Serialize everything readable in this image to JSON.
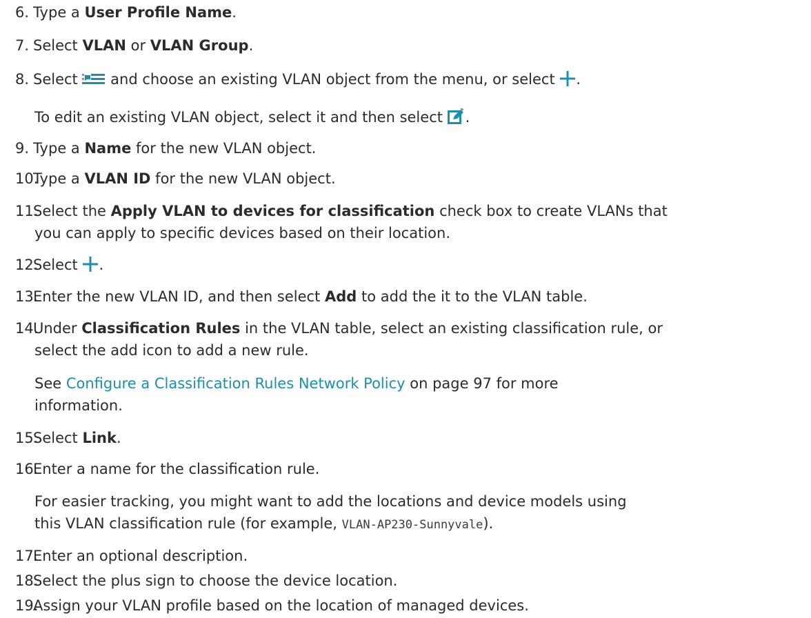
{
  "steps": [
    {
      "num": "6.",
      "pre": "Type a ",
      "bold": "User Profile Name",
      "post": "."
    },
    {
      "num": "7.",
      "pre": "Select ",
      "bold": "VLAN",
      "mid": " or ",
      "bold2": "VLAN Group",
      "post": "."
    },
    {
      "num": "8.",
      "pre": "Select ",
      "mid": " and choose an existing VLAN object from the menu, or select ",
      "post": "."
    },
    {
      "num": "9.",
      "pre": "Type a ",
      "bold": "Name",
      "post": " for the new VLAN object."
    },
    {
      "num": "10.",
      "pre": "Type a ",
      "bold": "VLAN ID",
      "post": " for the new VLAN object."
    },
    {
      "num": "11.",
      "pre": "Select the ",
      "bold": "Apply VLAN to devices for classification",
      "post": " check box to create VLANs that",
      "line2": "you can apply to specific devices based on their location."
    },
    {
      "num": "12.",
      "pre": "Select ",
      "post": "."
    },
    {
      "num": "13.",
      "pre": "Enter the new VLAN ID, and then select ",
      "bold": "Add",
      "post": " to add the it to the VLAN table."
    },
    {
      "num": "14.",
      "pre": "Under ",
      "bold": "Classification Rules",
      "post": " in the VLAN table, select an existing classification rule, or",
      "line2": "select the add icon to add a new rule."
    },
    {
      "num": "15.",
      "pre": "Select ",
      "bold": "Link",
      "post": "."
    },
    {
      "num": "16.",
      "pre": "Enter a name for the classification rule."
    },
    {
      "num": "17.",
      "pre": "Enter an optional description."
    },
    {
      "num": "18.",
      "pre": "Select the plus sign to choose the device location."
    },
    {
      "num": "19.",
      "pre": "Assign your VLAN profile based on the location of managed devices."
    }
  ],
  "notes": {
    "step8": {
      "text": "To edit an existing VLAN object, select it and then select ",
      "post": "."
    },
    "step14": {
      "link": "Configure a Classification Rules Network Policy",
      "post": " on page 97 for more",
      "pre": "See ",
      "line2": "information."
    },
    "step16": {
      "line1": "For easier tracking, you might want to add the locations and device models using",
      "pre2": "this VLAN classification rule (for example, ",
      "code": "VLAN-AP230-Sunnyvale",
      "post2": ")."
    }
  },
  "colors": {
    "text": "#2b2b2b",
    "link": "#1a8fb0",
    "icon_teal": "#1a8fb0",
    "icon_gray": "#8a9099"
  },
  "icons": [
    "list-select-icon",
    "plus-icon",
    "edit-icon"
  ]
}
